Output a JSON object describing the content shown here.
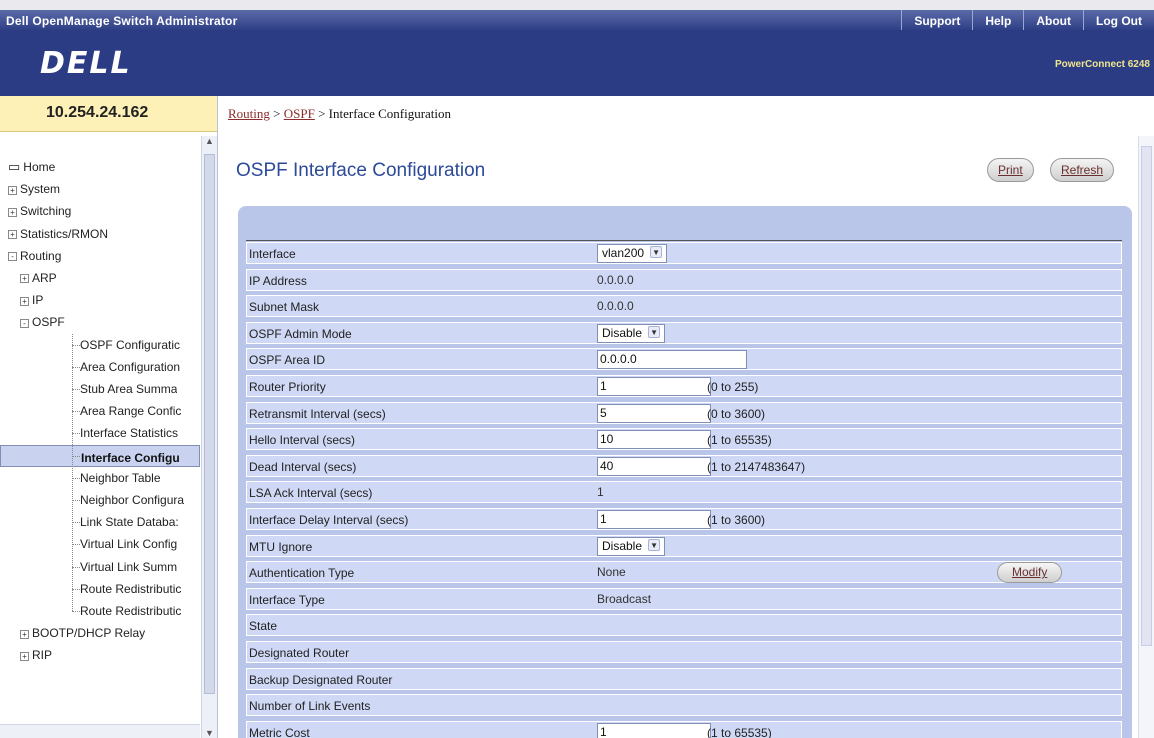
{
  "topbar": {
    "title": "Dell OpenManage Switch Administrator",
    "links": [
      "Support",
      "Help",
      "About",
      "Log Out"
    ]
  },
  "brand": {
    "logo": "DELL",
    "product": "PowerConnect 6248"
  },
  "sidebar": {
    "ip": "10.254.24.162",
    "tree": [
      {
        "label": "Home",
        "level": 0,
        "icon": "home-icon",
        "expander": ""
      },
      {
        "label": "System",
        "level": 0,
        "expander": "+"
      },
      {
        "label": "Switching",
        "level": 0,
        "expander": "+"
      },
      {
        "label": "Statistics/RMON",
        "level": 0,
        "expander": "+"
      },
      {
        "label": "Routing",
        "level": 0,
        "expander": "-"
      },
      {
        "label": "ARP",
        "level": 1,
        "expander": "+"
      },
      {
        "label": "IP",
        "level": 1,
        "expander": "+"
      },
      {
        "label": "OSPF",
        "level": 1,
        "expander": "-"
      },
      {
        "label": "OSPF Configuratic",
        "level": 2,
        "expander": ""
      },
      {
        "label": "Area Configuration",
        "level": 2,
        "expander": ""
      },
      {
        "label": "Stub Area Summa",
        "level": 2,
        "expander": ""
      },
      {
        "label": "Area Range Confic",
        "level": 2,
        "expander": ""
      },
      {
        "label": "Interface Statistics",
        "level": 2,
        "expander": ""
      },
      {
        "label": "Interface Configu",
        "level": 2,
        "expander": "",
        "selected": true
      },
      {
        "label": "Neighbor Table",
        "level": 2,
        "expander": ""
      },
      {
        "label": "Neighbor Configura",
        "level": 2,
        "expander": ""
      },
      {
        "label": "Link State Databa:",
        "level": 2,
        "expander": ""
      },
      {
        "label": "Virtual Link Config",
        "level": 2,
        "expander": ""
      },
      {
        "label": "Virtual Link Summ",
        "level": 2,
        "expander": ""
      },
      {
        "label": "Route Redistributic",
        "level": 2,
        "expander": ""
      },
      {
        "label": "Route Redistributic",
        "level": 2,
        "expander": ""
      },
      {
        "label": "BOOTP/DHCP Relay",
        "level": 1,
        "expander": "+"
      },
      {
        "label": "RIP",
        "level": 1,
        "expander": "+"
      }
    ]
  },
  "breadcrumb": {
    "link1": "Routing",
    "sep1": " > ",
    "link2": "OSPF",
    "sep2": " > ",
    "current": "Interface Configuration"
  },
  "page": {
    "title": "OSPF Interface Configuration",
    "print_label": "Print",
    "refresh_label": "Refresh",
    "modify_label": "Modify"
  },
  "form": {
    "rows": [
      {
        "label": "Interface",
        "type": "select",
        "value": "vlan200"
      },
      {
        "label": "IP Address",
        "type": "text",
        "value": "0.0.0.0"
      },
      {
        "label": "Subnet Mask",
        "type": "text",
        "value": "0.0.0.0"
      },
      {
        "label": "OSPF Admin Mode",
        "type": "select",
        "value": "Disable"
      },
      {
        "label": "OSPF Area ID",
        "type": "input",
        "value": "0.0.0.0",
        "wide": true
      },
      {
        "label": "Router Priority",
        "type": "input",
        "value": "1",
        "range": "(0 to 255)"
      },
      {
        "label": "Retransmit Interval (secs)",
        "type": "input",
        "value": "5",
        "range": "(0 to 3600)"
      },
      {
        "label": "Hello Interval (secs)",
        "type": "input",
        "value": "10",
        "range": "(1 to 65535)"
      },
      {
        "label": "Dead Interval (secs)",
        "type": "input",
        "value": "40",
        "range": "(1 to 2147483647)"
      },
      {
        "label": "LSA Ack Interval (secs)",
        "type": "text",
        "value": "1"
      },
      {
        "label": "Interface Delay Interval (secs)",
        "type": "input",
        "value": "1",
        "range": "(1 to 3600)"
      },
      {
        "label": "MTU Ignore",
        "type": "select",
        "value": "Disable"
      },
      {
        "label": "Authentication Type",
        "type": "text",
        "value": "None",
        "button": true
      },
      {
        "label": "Interface Type",
        "type": "text",
        "value": "Broadcast"
      },
      {
        "label": "State",
        "type": "text",
        "value": ""
      },
      {
        "label": "Designated Router",
        "type": "text",
        "value": ""
      },
      {
        "label": "Backup Designated Router",
        "type": "text",
        "value": ""
      },
      {
        "label": "Number of Link Events",
        "type": "text",
        "value": ""
      },
      {
        "label": "Metric Cost",
        "type": "input",
        "value": "1",
        "range": "(1 to 65535)"
      }
    ]
  }
}
